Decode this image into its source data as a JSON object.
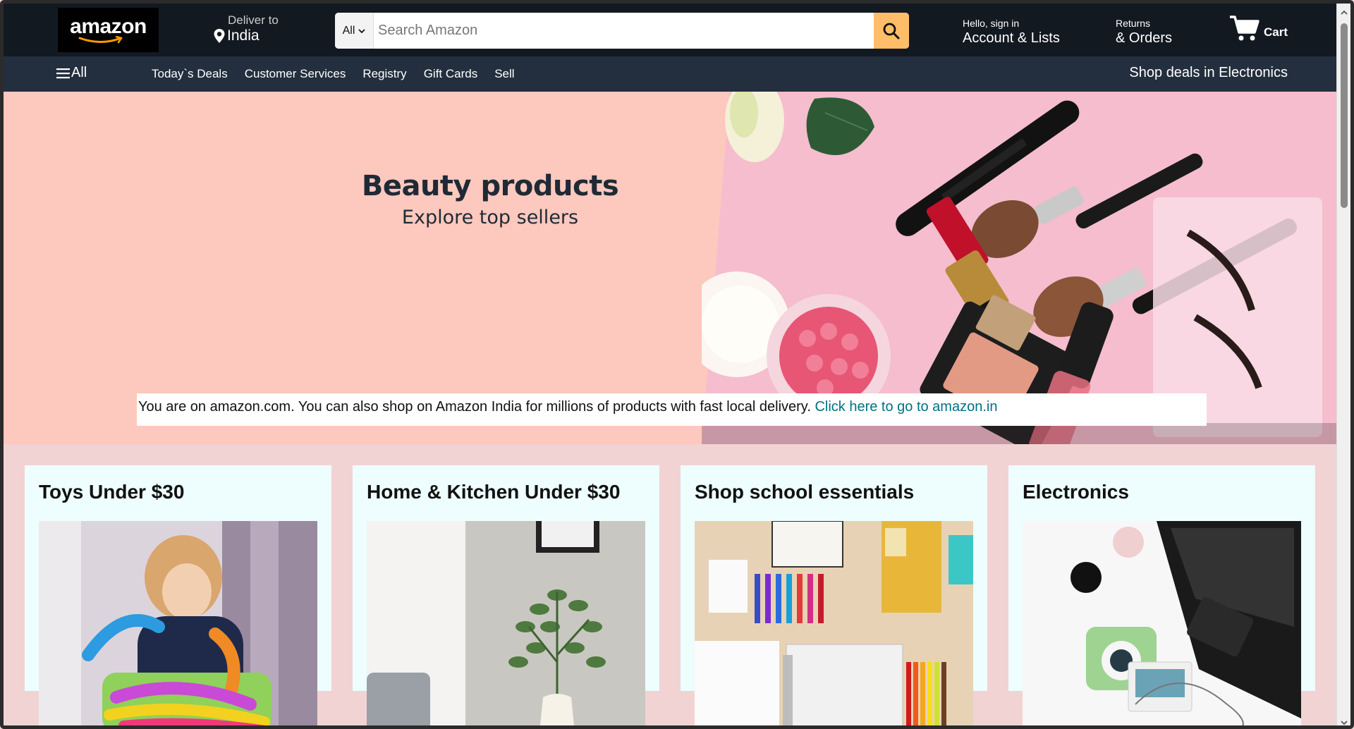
{
  "header": {
    "logo_text": "amazon",
    "deliver_label": "Deliver to",
    "deliver_location": "India",
    "search_category": "All",
    "search_placeholder": "Search Amazon",
    "account_small": "Hello, sign in",
    "account_big": "Account & Lists",
    "returns_small": "Returns",
    "returns_big": "& Orders",
    "cart_label": "Cart"
  },
  "subnav": {
    "all_label": "All",
    "links": [
      "Today`s Deals",
      "Customer Services",
      "Registry",
      "Gift Cards",
      "Sell"
    ],
    "deal_text": "Shop deals in Electronics"
  },
  "hero": {
    "title": "Beauty products",
    "subtitle": "Explore top sellers",
    "notice_text": "You are on amazon.com. You can also shop on Amazon India for millions of products with fast local delivery. ",
    "notice_link": "Click here to go to amazon.in"
  },
  "cards": [
    {
      "title": "Toys Under $30"
    },
    {
      "title": "Home & Kitchen Under $30"
    },
    {
      "title": "Shop school essentials"
    },
    {
      "title": "Electronics"
    }
  ],
  "colors": {
    "nav_bg": "#131921",
    "subnav_bg": "#232f3e",
    "search_button": "#febd69",
    "hero_bg": "#fdc8bd",
    "link": "#007185",
    "card_bg": "#eefdfd"
  }
}
